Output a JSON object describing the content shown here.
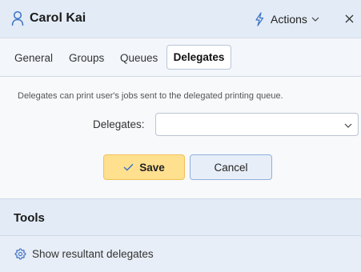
{
  "header": {
    "title": "Carol Kai",
    "actions_label": "Actions",
    "icons": {
      "user": "user-icon",
      "actions": "lightning-bolt-icon",
      "chevron": "chevron-down-icon",
      "close": "close-icon"
    },
    "close_glyph": "✕"
  },
  "tabs": [
    {
      "label": "General",
      "active": false
    },
    {
      "label": "Groups",
      "active": false
    },
    {
      "label": "Queues",
      "active": false
    },
    {
      "label": "Delegates",
      "active": true
    }
  ],
  "delegates": {
    "description": "Delegates can print user's jobs sent to the delegated printing queue.",
    "field_label": "Delegates:",
    "field_value": ""
  },
  "buttons": {
    "save_label": "Save",
    "cancel_label": "Cancel"
  },
  "tools": {
    "title": "Tools",
    "items": [
      {
        "label": "Show resultant delegates",
        "icon": "gear-icon"
      }
    ]
  },
  "colors": {
    "header_bg": "#e3ebf6",
    "save_bg": "#ffe08f",
    "cancel_border": "#8fb0dc",
    "accent_blue": "#3b73c4"
  }
}
